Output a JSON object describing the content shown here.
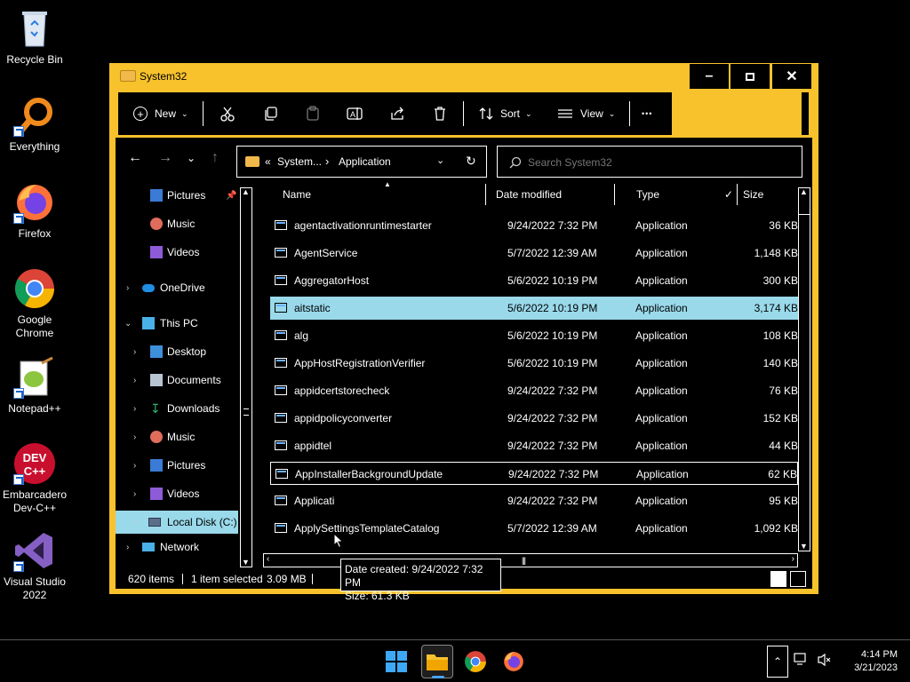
{
  "desktop": {
    "icons": [
      {
        "label": "Recycle Bin",
        "icon": "recycle-bin-icon"
      },
      {
        "label": "Everything",
        "icon": "everything-search-icon"
      },
      {
        "label": "Firefox",
        "icon": "firefox-icon"
      },
      {
        "label": "Google Chrome",
        "icon": "chrome-icon"
      },
      {
        "label": "Notepad++",
        "icon": "notepadpp-icon"
      },
      {
        "label": "Embarcadero Dev-C++",
        "icon": "devcpp-icon"
      },
      {
        "label": "Visual Studio 2022",
        "icon": "visual-studio-icon"
      }
    ]
  },
  "window": {
    "title": "System32",
    "accent": "#f7c22c",
    "controls": {
      "minimize": "–",
      "maximize": "□",
      "close": "✕"
    }
  },
  "cmdbar": {
    "new_label": "New",
    "sort_label": "Sort",
    "view_label": "View",
    "more_label": "•••"
  },
  "address": {
    "prefix": "«",
    "segment1": "System...",
    "separator": "›",
    "segment2": "Application"
  },
  "search": {
    "placeholder": "Search System32"
  },
  "nav": {
    "items": [
      {
        "label": "Pictures",
        "icon": "pictures-icon"
      },
      {
        "label": "Music",
        "icon": "music-icon"
      },
      {
        "label": "Videos",
        "icon": "videos-icon"
      },
      {
        "label": "OneDrive",
        "icon": "onedrive-icon"
      },
      {
        "label": "This PC",
        "icon": "this-pc-icon"
      },
      {
        "label": "Desktop",
        "icon": "desktop-folder-icon"
      },
      {
        "label": "Documents",
        "icon": "documents-icon"
      },
      {
        "label": "Downloads",
        "icon": "downloads-icon"
      },
      {
        "label": "Music",
        "icon": "music-icon"
      },
      {
        "label": "Pictures",
        "icon": "pictures-icon"
      },
      {
        "label": "Videos",
        "icon": "videos-icon"
      },
      {
        "label": "Local Disk (C:)",
        "icon": "local-disk-icon"
      },
      {
        "label": "Network",
        "icon": "network-icon"
      }
    ]
  },
  "columns": {
    "name": "Name",
    "date": "Date modified",
    "type": "Type",
    "size": "Size"
  },
  "files": [
    {
      "name": "agentactivationruntimestarter",
      "date": "9/24/2022 7:32 PM",
      "type": "Application",
      "size": "36 KB"
    },
    {
      "name": "AgentService",
      "date": "5/7/2022 12:39 AM",
      "type": "Application",
      "size": "1,148 KB"
    },
    {
      "name": "AggregatorHost",
      "date": "5/6/2022 10:19 PM",
      "type": "Application",
      "size": "300 KB"
    },
    {
      "name": "aitstatic",
      "date": "5/6/2022 10:19 PM",
      "type": "Application",
      "size": "3,174 KB"
    },
    {
      "name": "alg",
      "date": "5/6/2022 10:19 PM",
      "type": "Application",
      "size": "108 KB"
    },
    {
      "name": "AppHostRegistrationVerifier",
      "date": "5/6/2022 10:19 PM",
      "type": "Application",
      "size": "140 KB"
    },
    {
      "name": "appidcertstorecheck",
      "date": "9/24/2022 7:32 PM",
      "type": "Application",
      "size": "76 KB"
    },
    {
      "name": "appidpolicyconverter",
      "date": "9/24/2022 7:32 PM",
      "type": "Application",
      "size": "152 KB"
    },
    {
      "name": "appidtel",
      "date": "9/24/2022 7:32 PM",
      "type": "Application",
      "size": "44 KB"
    },
    {
      "name": "AppInstallerBackgroundUpdate",
      "date": "9/24/2022 7:32 PM",
      "type": "Application",
      "size": "62 KB"
    },
    {
      "name": "Applicati",
      "date": "9/24/2022 7:32 PM",
      "type": "Application",
      "size": "95 KB"
    },
    {
      "name": "ApplySettingsTemplateCatalog",
      "date": "5/7/2022 12:39 AM",
      "type": "Application",
      "size": "1,092 KB"
    }
  ],
  "tooltip": {
    "line1": "Date created: 9/24/2022 7:32 PM",
    "line2": "Size: 61.3 KB"
  },
  "status": {
    "count": "620 items",
    "selection": "1 item selected",
    "selsize": "3.09 MB"
  },
  "taskbar": {
    "time": "4:14 PM",
    "date": "3/21/2023"
  }
}
